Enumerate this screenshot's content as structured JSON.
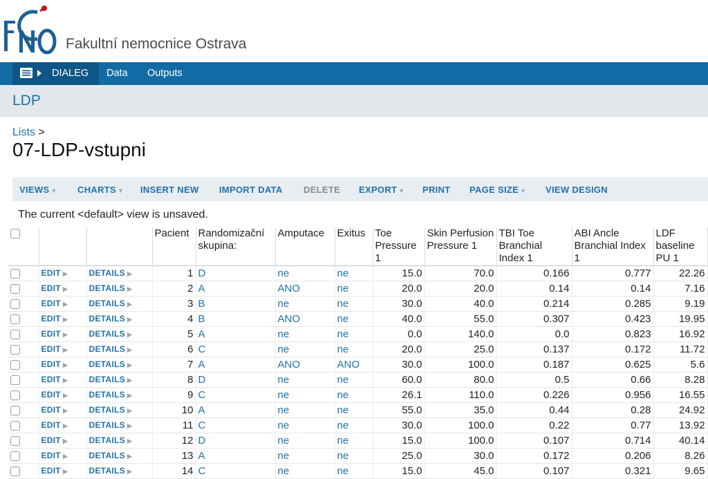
{
  "header": {
    "org_name": "Fakultní nemocnice Ostrava"
  },
  "nav": {
    "home_label": "DIALEG",
    "items": [
      "Data",
      "Outputs"
    ]
  },
  "colors": {
    "nav_bg": "#126ba4",
    "link": "#1f72a8",
    "toolbar_bg": "#e8edf1"
  },
  "page": {
    "section_title": "LDP",
    "breadcrumb_link": "Lists",
    "breadcrumb_sep": ">",
    "list_title": "07-LDP-vstupni"
  },
  "toolbar": {
    "views": "VIEWS",
    "charts": "CHARTS",
    "insert_new": "INSERT NEW",
    "import_data": "IMPORT DATA",
    "delete": "DELETE",
    "export": "EXPORT",
    "print": "PRINT",
    "page_size": "PAGE SIZE",
    "view_design": "VIEW DESIGN"
  },
  "view_message": "The current <default> view is unsaved.",
  "table": {
    "edit_label": "EDIT",
    "details_label": "DETAILS",
    "headers": [
      "Pacient",
      "Randomizační skupina:",
      "Amputace",
      "Exitus",
      "Toe Pressure 1",
      "Skin Perfusion Pressure 1",
      "TBI Toe Branchial Index 1",
      "ABI Ancle Branchial Index 1",
      "LDF baseline PU 1"
    ],
    "rows": [
      [
        "1",
        "D",
        "ne",
        "ne",
        "15.0",
        "70.0",
        "0.166",
        "0.777",
        "22.26"
      ],
      [
        "2",
        "A",
        "ANO",
        "ne",
        "20.0",
        "20.0",
        "0.14",
        "0.14",
        "7.16"
      ],
      [
        "3",
        "B",
        "ne",
        "ne",
        "30.0",
        "40.0",
        "0.214",
        "0.285",
        "9.19"
      ],
      [
        "4",
        "B",
        "ANO",
        "ne",
        "40.0",
        "55.0",
        "0.307",
        "0.423",
        "19.95"
      ],
      [
        "5",
        "A",
        "ne",
        "ne",
        "0.0",
        "140.0",
        "0.0",
        "0.823",
        "16.92"
      ],
      [
        "6",
        "C",
        "ne",
        "ne",
        "20.0",
        "25.0",
        "0.137",
        "0.172",
        "11.72"
      ],
      [
        "7",
        "A",
        "ANO",
        "ANO",
        "30.0",
        "100.0",
        "0.187",
        "0.625",
        "5.6"
      ],
      [
        "8",
        "D",
        "ne",
        "ne",
        "60.0",
        "80.0",
        "0.5",
        "0.66",
        "8.28"
      ],
      [
        "9",
        "C",
        "ne",
        "ne",
        "26.1",
        "110.0",
        "0.226",
        "0.956",
        "16.55"
      ],
      [
        "10",
        "A",
        "ne",
        "ne",
        "55.0",
        "35.0",
        "0.44",
        "0.28",
        "24.92"
      ],
      [
        "11",
        "C",
        "ne",
        "ne",
        "30.0",
        "100.0",
        "0.22",
        "0.77",
        "13.92"
      ],
      [
        "12",
        "D",
        "ne",
        "ne",
        "15.0",
        "100.0",
        "0.107",
        "0.714",
        "40.14"
      ],
      [
        "13",
        "A",
        "ne",
        "ne",
        "25.0",
        "30.0",
        "0.172",
        "0.206",
        "8.26"
      ],
      [
        "14",
        "C",
        "ne",
        "ne",
        "15.0",
        "45.0",
        "0.107",
        "0.321",
        "9.65"
      ]
    ]
  }
}
